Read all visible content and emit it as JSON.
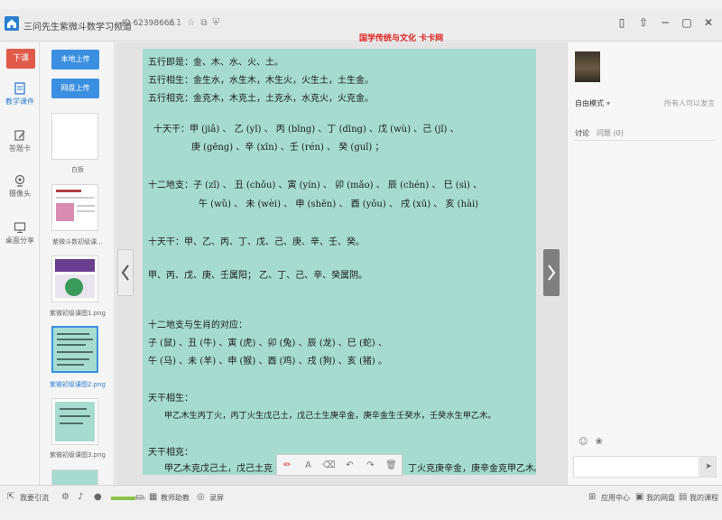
{
  "app": {
    "title": "三问先生紫微斗数学习频道",
    "room_id": "ID 62398666",
    "viewer_count": "1",
    "banner": "国学传统与文化 卡卡网"
  },
  "window": {
    "minimize": "─",
    "restore": "▢",
    "close": "✕",
    "phone_icon": "▯",
    "up_icon": "⇧"
  },
  "leftnav": {
    "down_button": "下课",
    "items": [
      {
        "label": "教学课件",
        "icon": "doc-icon",
        "active": true
      },
      {
        "label": "答题卡",
        "icon": "pencil-icon",
        "active": false
      },
      {
        "label": "摄像头",
        "icon": "camera-icon",
        "active": false
      },
      {
        "label": "桌面分享",
        "icon": "monitor-icon",
        "active": false
      }
    ]
  },
  "thumbs": {
    "upload_local": "本地上传",
    "upload_cloud": "网盘上传",
    "items": [
      {
        "label": "白板",
        "selected": false
      },
      {
        "label": "紫微斗数初级课...",
        "selected": false
      },
      {
        "label": "紫微初级课图1.png",
        "selected": false
      },
      {
        "label": "紫微初级课图2.png",
        "selected": true
      },
      {
        "label": "紫微初级课图3.png",
        "selected": false
      }
    ]
  },
  "document": {
    "lines": [
      "五行即是：金、木、水、火、土。",
      "五行相生：金生水，水生木，木生火，火生土，土生金。",
      "五行相克：金克木，木克土，土克水，水克火，火克金。",
      "十天干：甲 (jiǎ) 、 乙 (yǐ) 、 丙 (bǐng) 、丁 (dīng) 、戊 (wù) 、己 (jǐ) 、",
      "庚 (gēng) 、辛 (xīn) 、壬 (rén) 、 癸 (guǐ) ；",
      "十二地支：子 (zǐ) 、 丑 (chǒu) 、寅 (yín) 、  卯 (mǎo) 、 辰 (chén) 、  巳 (sì) 、",
      "午 (wǔ) 、 未 (wèi) 、 申 (shēn) 、 酉 (yǒu) 、 戌 (xū) 、   亥 (hài)",
      "十天干：甲、乙、丙、丁、戊、己、庚、辛、壬、癸。",
      "甲、丙、戊、庚、壬属阳；  乙、丁、己、辛、癸属阴。",
      "十二地支与生肖的对应：",
      "子 (鼠) 、丑 (牛) 、寅 (虎) 、卯 (兔) 、辰 (龙) 、巳 (蛇) 、",
      "午 (马) 、未 (羊) 、申 (猴) 、酉 (鸡) 、戌 (狗) 、亥 (猪) 。",
      "天干相生：",
      "甲乙木生丙丁火，丙丁火生戊己土，戊己土生庚辛金，庚辛金生壬癸水，壬癸水生甲乙木。",
      "天干相克：",
      "甲乙木克戊己土，戊己土克",
      "丁火克庚辛金，庚辛金克甲乙木。"
    ],
    "bg_color": "#a6dcd0"
  },
  "toolbar": {
    "pen": "✏",
    "text": "A",
    "eraser": "⌫",
    "undo": "↶",
    "redo": "↷",
    "clear": "🗑"
  },
  "rightpanel": {
    "mode": "自由模式",
    "mode_caret": "▾",
    "who_can_speak": "所有人可以发言",
    "tab_discuss": "讨论",
    "tab_question": "问题 (0)",
    "emoji_icon": "☺",
    "flower_icon": "❀",
    "send_icon": "➤"
  },
  "statusbar": {
    "grow": "我要引流",
    "volume_level": 0.7,
    "member_manage": "教师助教",
    "record": "录屏",
    "app_center": "应用中心",
    "my_disk": "我的网盘",
    "my_course": "我的课程"
  }
}
